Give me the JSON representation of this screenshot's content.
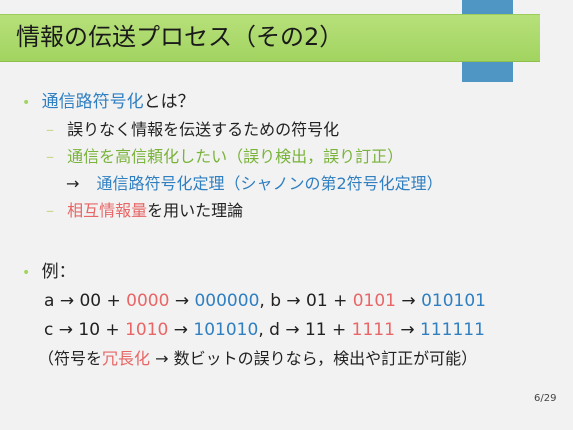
{
  "slide": {
    "title": "情報の伝送プロセス（その2）",
    "page": "6/29",
    "bullet1": {
      "head_blue": "通信路符号化",
      "head_rest": "とは？",
      "sub1": "誤りなく情報を伝送するための符号化",
      "sub2": "通信を高信頼化したい（誤り検出，誤り訂正）",
      "arrow_line": {
        "arrow": "→",
        "text": "通信路符号化定理（シャノンの第2符号化定理）"
      },
      "sub3_red": "相互情報量",
      "sub3_rest": "を用いた理論"
    },
    "bullet2": {
      "head": "例：",
      "line1": {
        "a": "a → 00 + ",
        "a_red": "0000",
        "a_arrow": " → ",
        "a_blue": "000000",
        "b": ", b → 01 + ",
        "b_red": "0101",
        "b_arrow": " → ",
        "b_blue": "010101"
      },
      "line2": {
        "c": "c → 10 + ",
        "c_red": "1010",
        "c_arrow": " → ",
        "c_blue": "101010",
        "d": ", d → 11 + ",
        "d_red": "1111",
        "d_arrow": " → ",
        "d_blue": "111111"
      },
      "line3": {
        "pre": "（符号を",
        "red": "冗長化",
        "post": " → 数ビットの誤りなら，検出や訂正が可能）"
      }
    },
    "colors": {
      "title_bar": "#a2d461",
      "blue": "#2f7fc1",
      "green": "#79b33a",
      "red": "#e86666",
      "accent_bar": "#4f96c4"
    }
  }
}
